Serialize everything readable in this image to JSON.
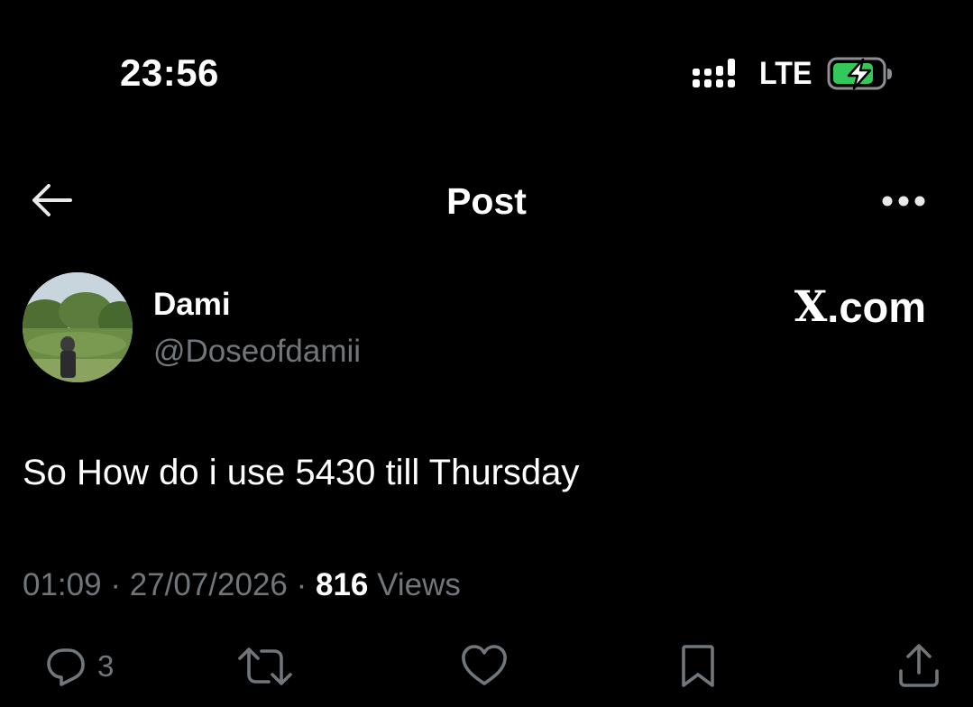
{
  "status_bar": {
    "time": "23:56",
    "network": "LTE",
    "signal_icon": "cellular-signal-icon",
    "battery_icon": "battery-charging-icon",
    "battery_color": "#34c759"
  },
  "header": {
    "title": "Post",
    "back_icon": "arrow-left-icon",
    "more_icon": "more-horizontal-icon"
  },
  "author": {
    "name": "Dami",
    "handle": "@Doseofdamii",
    "avatar": "user-avatar-photo"
  },
  "watermark": {
    "logo": "X",
    "suffix": ".com"
  },
  "post": {
    "text": "So How do i use 5430 till Thursday",
    "time": "01:09",
    "separator": " · ",
    "date": "27/07/2026",
    "views_count": "816",
    "views_label": " Views"
  },
  "actions": {
    "reply_count": "3",
    "reply_icon": "reply-icon",
    "repost_icon": "repost-icon",
    "like_icon": "heart-icon",
    "bookmark_icon": "bookmark-icon",
    "share_icon": "share-icon",
    "icon_color": "#71767b"
  }
}
